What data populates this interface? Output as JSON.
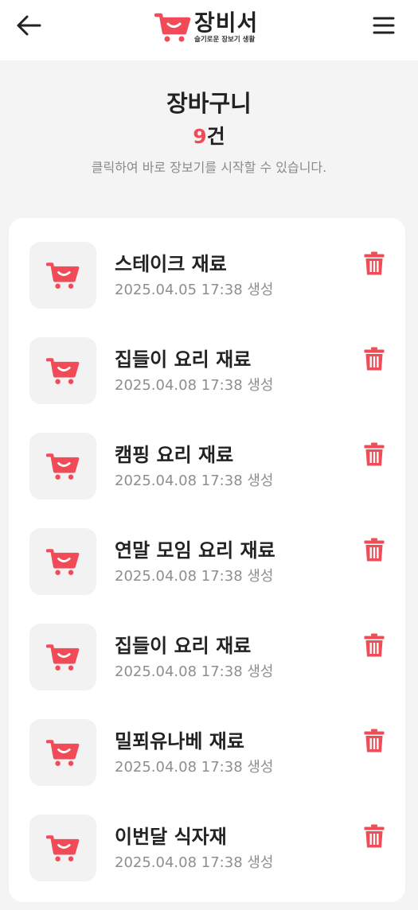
{
  "header": {
    "back_icon": "arrow-left-icon",
    "menu_icon": "hamburger-menu-icon",
    "brand_name": "장비서",
    "brand_tagline": "슬기로운 장보기 생활",
    "brand_logo_icon": "shopping-cart-logo-icon"
  },
  "summary": {
    "title": "장바구니",
    "count": "9",
    "count_unit": "건",
    "hint": "클릭하여 바로 장보기를 시작할 수 있습니다."
  },
  "colors": {
    "accent": "#f04b57",
    "background": "#f4f4f4",
    "card": "#ffffff",
    "thumb": "#f2f2f2"
  },
  "items": [
    {
      "title": "스테이크 재료",
      "date": "2025.04.05 17:38 생성",
      "icon": "shopping-cart-icon",
      "delete_icon": "trash-icon"
    },
    {
      "title": "집들이 요리 재료",
      "date": "2025.04.08 17:38 생성",
      "icon": "shopping-cart-icon",
      "delete_icon": "trash-icon"
    },
    {
      "title": "캠핑 요리 재료",
      "date": "2025.04.08 17:38 생성",
      "icon": "shopping-cart-icon",
      "delete_icon": "trash-icon"
    },
    {
      "title": "연말 모임 요리 재료",
      "date": "2025.04.08 17:38 생성",
      "icon": "shopping-cart-icon",
      "delete_icon": "trash-icon"
    },
    {
      "title": "집들이 요리 재료",
      "date": "2025.04.08 17:38 생성",
      "icon": "shopping-cart-icon",
      "delete_icon": "trash-icon"
    },
    {
      "title": "밀푀유나베 재료",
      "date": "2025.04.08 17:38 생성",
      "icon": "shopping-cart-icon",
      "delete_icon": "trash-icon"
    },
    {
      "title": "이번달 식자재",
      "date": "2025.04.08 17:38 생성",
      "icon": "shopping-cart-icon",
      "delete_icon": "trash-icon"
    }
  ]
}
